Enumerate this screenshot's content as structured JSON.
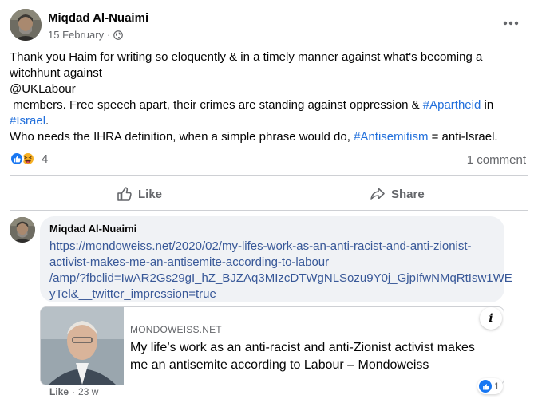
{
  "post": {
    "author": "Miqdad Al-Nuaimi",
    "date": "15 February",
    "separator": "·",
    "audience_icon": "globe-icon",
    "more_icon": "more-horizontal-icon",
    "text_lines": [
      [
        "Thank you Haim for writing so eloquently & in a timely manner against what's becoming a"
      ],
      [
        "witchhunt against"
      ],
      [
        "@UKLabour"
      ],
      [
        " members. Free speech apart, their crimes are standing against oppression & ",
        {
          "tag": "#Apartheid"
        },
        " in"
      ],
      [
        {
          "tag": "#Israel"
        },
        "."
      ],
      [
        "Who needs the IHRA definition, when a simple phrase would do, ",
        {
          "tag": "#Antisemitism"
        },
        " = anti-Israel."
      ]
    ],
    "reaction_icons": [
      "like-icon",
      "haha-icon"
    ],
    "reaction_count": "4",
    "comment_count": "1 comment"
  },
  "actions": {
    "like_label": "Like",
    "share_label": "Share"
  },
  "comment": {
    "author": "Miqdad Al-Nuaimi",
    "link_lines": [
      "https://mondoweiss.net/2020/02/my-lifes-work-as-an-anti-racist-and-anti-zionist-",
      "activist-makes-me-an-antisemite-according-to-labour",
      "/amp/?fbclid=IwAR2Gs29gI_hZ_BJZAq3MIzcDTWgNLSozu9Y0j_GjpIfwNMqRtIsw1WE",
      "yTel&__twitter_impression=true"
    ],
    "preview": {
      "domain": "MONDOWEISS.NET",
      "title_lines": [
        "My life’s work as an anti-racist and anti-Zionist activist makes",
        "me an antisemite according to Labour – Mondoweiss"
      ],
      "info_label": "i"
    },
    "like_label": "Like",
    "separator": "·",
    "time": "23 w",
    "reaction_count": "1"
  },
  "colors": {
    "hashtag": "#216fdb",
    "link": "#385898",
    "secondary_text": "#65676b",
    "like_blue": "#1877f2",
    "haha_yellow": "#f7b125",
    "bubble_bg": "#f0f2f5",
    "divider": "#ced0d4"
  }
}
